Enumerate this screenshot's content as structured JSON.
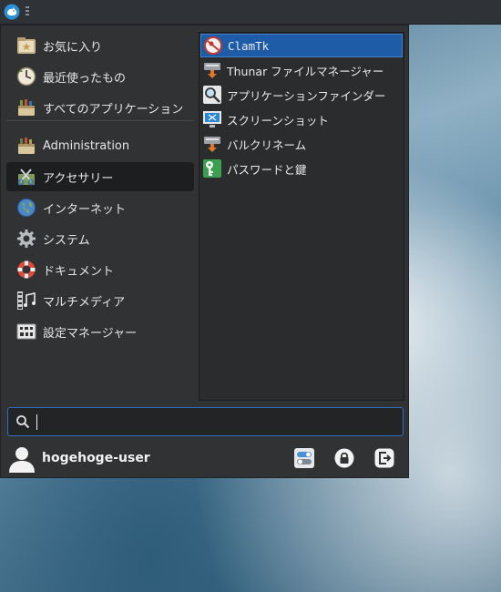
{
  "categories": [
    {
      "label": "お気に入り",
      "icon": "favorites-icon"
    },
    {
      "label": "最近使ったもの",
      "icon": "recent-icon"
    },
    {
      "label": "すべてのアプリケーション",
      "icon": "all-apps-icon"
    },
    {
      "label": "Administration",
      "icon": "administration-icon"
    },
    {
      "label": "アクセサリー",
      "icon": "accessories-icon",
      "active": true
    },
    {
      "label": "インターネット",
      "icon": "internet-icon"
    },
    {
      "label": "システム",
      "icon": "system-icon"
    },
    {
      "label": "ドキュメント",
      "icon": "documents-icon"
    },
    {
      "label": "マルチメディア",
      "icon": "multimedia-icon"
    },
    {
      "label": "設定マネージャー",
      "icon": "settings-manager-icon"
    }
  ],
  "apps": [
    {
      "label": "ClamTk",
      "icon": "clamtk-icon",
      "selected": true
    },
    {
      "label": "Thunar ファイルマネージャー",
      "icon": "thunar-icon"
    },
    {
      "label": "アプリケーションファインダー",
      "icon": "appfinder-icon"
    },
    {
      "label": "スクリーンショット",
      "icon": "screenshot-icon"
    },
    {
      "label": "バルクリネーム",
      "icon": "bulk-rename-icon"
    },
    {
      "label": "パスワードと鍵",
      "icon": "password-keys-icon"
    }
  ],
  "search": {
    "value": "",
    "placeholder": ""
  },
  "user": {
    "name": "hogehoge-user"
  },
  "colors": {
    "accent": "#1f5ca8",
    "menu_bg": "#303234",
    "panel_bg": "#2f3236"
  }
}
